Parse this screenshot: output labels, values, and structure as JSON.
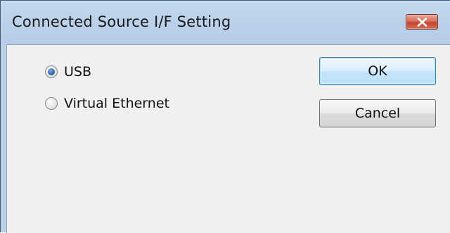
{
  "window": {
    "title": "Connected Source I/F Setting",
    "close_icon": "close-icon"
  },
  "options": [
    {
      "label": "USB",
      "selected": true
    },
    {
      "label": "Virtual Ethernet",
      "selected": false
    }
  ],
  "buttons": {
    "ok_label": "OK",
    "cancel_label": "Cancel"
  },
  "colors": {
    "titlebar": "#bcd0e6",
    "client": "#f0f0f0",
    "close_button": "#c9543f",
    "radio_selected": "#2c64a8"
  }
}
